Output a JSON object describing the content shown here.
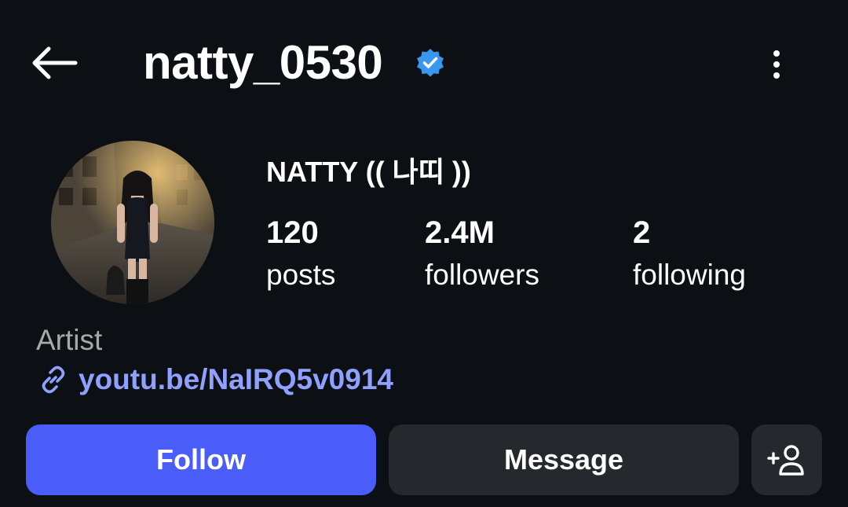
{
  "header": {
    "back_icon": "arrow-left-icon",
    "username": "natty_0530",
    "verified_icon": "verified-badge-icon",
    "verified_color": "#3897f0",
    "more_icon": "more-vertical-icon"
  },
  "profile": {
    "avatar_icon": "profile-photo",
    "display_name": "NATTY (( 나띠 ))",
    "stats": {
      "posts": {
        "value": "120",
        "label": "posts"
      },
      "followers": {
        "value": "2.4M",
        "label": "followers"
      },
      "following": {
        "value": "2",
        "label": "following"
      }
    },
    "category": "Artist",
    "link": {
      "icon": "link-icon",
      "text": "youtu.be/NaIRQ5v0914",
      "color": "#8fa0ff"
    }
  },
  "actions": {
    "follow_label": "Follow",
    "message_label": "Message",
    "add_user_icon": "add-user-icon",
    "follow_color": "#4a5df9",
    "secondary_color": "#25292e"
  },
  "theme": {
    "background": "#0c1014",
    "text": "#ffffff",
    "muted": "#a8a8a8"
  }
}
